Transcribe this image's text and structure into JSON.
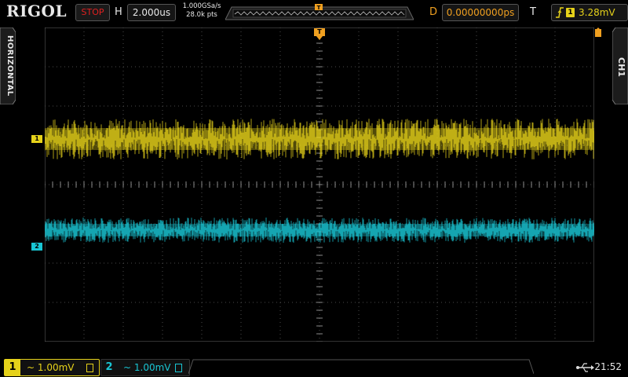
{
  "brand": "RIGOL",
  "run_status": "STOP",
  "horizontal": {
    "label": "H",
    "timebase": "2.000us",
    "sample_rate": "1.000GSa/s",
    "memory_depth": "28.0k pts"
  },
  "delay": {
    "label": "D",
    "value": "0.00000000ps"
  },
  "trigger": {
    "label": "T",
    "level": "3.28mV",
    "source": "1",
    "edge_icon": "rising-edge-icon"
  },
  "side_tabs": {
    "left": "HORIZONTAL",
    "right": "CH1"
  },
  "channels": [
    {
      "id": "1",
      "coupling": "~",
      "scale": "1.00mV",
      "color": "#e6d21a"
    },
    {
      "id": "2",
      "coupling": "~",
      "scale": "1.00mV",
      "color": "#19c6d4"
    }
  ],
  "clock": "21:52",
  "colors": {
    "ch1": "#e6d21a",
    "ch2": "#19c6d4",
    "trigger": "#f0a020",
    "status": "#e02020",
    "grid": "#555555"
  }
}
